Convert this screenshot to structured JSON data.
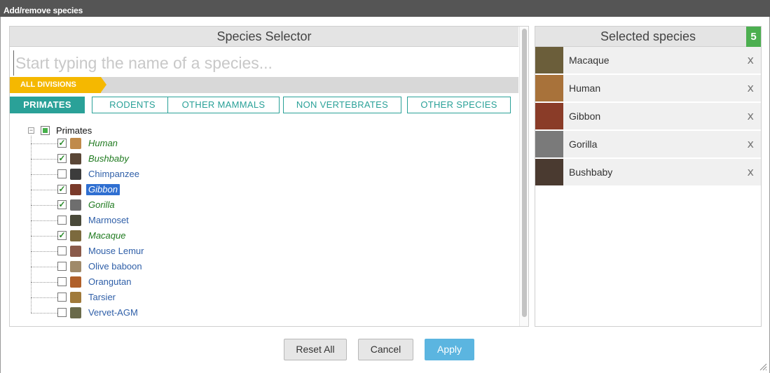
{
  "window": {
    "title": "Add/remove species"
  },
  "selector": {
    "title": "Species Selector",
    "search_placeholder": "Start typing the name of a species...",
    "breadcrumb": "ALL DIVISIONS",
    "tabs": [
      {
        "label": "PRIMATES",
        "active": true
      },
      {
        "label": "RODENTS",
        "active": false
      },
      {
        "label": "OTHER MAMMALS",
        "active": false
      },
      {
        "label": "NON VERTEBRATES",
        "active": false
      },
      {
        "label": "OTHER SPECIES",
        "active": false
      }
    ],
    "tree": {
      "root_label": "Primates",
      "expander": "−",
      "items": [
        {
          "label": "Human",
          "checked": true,
          "highlight": false,
          "icon": "human-thumb-icon",
          "color": "#c08a4a"
        },
        {
          "label": "Bushbaby",
          "checked": true,
          "highlight": false,
          "icon": "bushbaby-thumb-icon",
          "color": "#5a4636"
        },
        {
          "label": "Chimpanzee",
          "checked": false,
          "highlight": false,
          "icon": "chimpanzee-thumb-icon",
          "color": "#3c3c3c"
        },
        {
          "label": "Gibbon",
          "checked": true,
          "highlight": true,
          "icon": "gibbon-thumb-icon",
          "color": "#7a3a2a"
        },
        {
          "label": "Gorilla",
          "checked": true,
          "highlight": false,
          "icon": "gorilla-thumb-icon",
          "color": "#6e6e6e"
        },
        {
          "label": "Marmoset",
          "checked": false,
          "highlight": false,
          "icon": "marmoset-thumb-icon",
          "color": "#4a4a3a"
        },
        {
          "label": "Macaque",
          "checked": true,
          "highlight": false,
          "icon": "macaque-thumb-icon",
          "color": "#7c6a3e"
        },
        {
          "label": "Mouse Lemur",
          "checked": false,
          "highlight": false,
          "icon": "mouse-lemur-thumb-icon",
          "color": "#8a5a4a"
        },
        {
          "label": "Olive baboon",
          "checked": false,
          "highlight": false,
          "icon": "olive-baboon-thumb-icon",
          "color": "#a08a6a"
        },
        {
          "label": "Orangutan",
          "checked": false,
          "highlight": false,
          "icon": "orangutan-thumb-icon",
          "color": "#b0602a"
        },
        {
          "label": "Tarsier",
          "checked": false,
          "highlight": false,
          "icon": "tarsier-thumb-icon",
          "color": "#a07a3a"
        },
        {
          "label": "Vervet-AGM",
          "checked": false,
          "highlight": false,
          "icon": "vervet-agm-thumb-icon",
          "color": "#6a6a4a"
        }
      ]
    }
  },
  "selected": {
    "title": "Selected species",
    "count": "5",
    "remove_label": "x",
    "items": [
      {
        "label": "Macaque",
        "icon": "macaque-photo-icon",
        "color": "#6b5e3a"
      },
      {
        "label": "Human",
        "icon": "human-photo-icon",
        "color": "#a8723a"
      },
      {
        "label": "Gibbon",
        "icon": "gibbon-photo-icon",
        "color": "#8a3c28"
      },
      {
        "label": "Gorilla",
        "icon": "gorilla-photo-icon",
        "color": "#7a7a7a"
      },
      {
        "label": "Bushbaby",
        "icon": "bushbaby-photo-icon",
        "color": "#4a3a30"
      }
    ]
  },
  "footer": {
    "reset_label": "Reset All",
    "cancel_label": "Cancel",
    "apply_label": "Apply"
  },
  "colors": {
    "accent_teal": "#2aa198",
    "breadcrumb_yellow": "#f5b800",
    "count_green": "#4caf50",
    "apply_blue": "#5bb5e0",
    "highlight_blue": "#2f6fd1"
  }
}
